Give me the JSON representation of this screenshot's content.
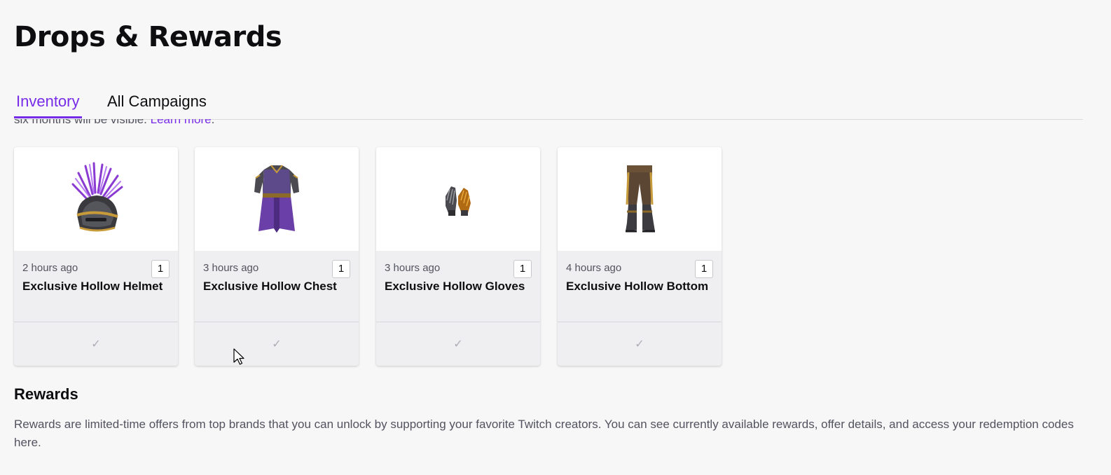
{
  "page": {
    "title": "Drops & Rewards"
  },
  "tabs": [
    {
      "label": "Inventory",
      "active": true
    },
    {
      "label": "All Campaigns",
      "active": false
    }
  ],
  "inventory_notice": {
    "text_visible": "six months will be visible. ",
    "link": "Learn more",
    "trailing": "."
  },
  "cards": [
    {
      "time": "2 hours ago",
      "quantity": "1",
      "name": "Exclusive Hollow Helmet",
      "icon": "helmet-image",
      "status_icon": "check-icon"
    },
    {
      "time": "3 hours ago",
      "quantity": "1",
      "name": "Exclusive Hollow Chest",
      "icon": "chest-armor-image",
      "status_icon": "check-icon"
    },
    {
      "time": "3 hours ago",
      "quantity": "1",
      "name": "Exclusive Hollow Gloves",
      "icon": "gloves-image",
      "status_icon": "check-icon"
    },
    {
      "time": "4 hours ago",
      "quantity": "1",
      "name": "Exclusive Hollow Bottom",
      "icon": "pants-image",
      "status_icon": "check-icon"
    }
  ],
  "rewards": {
    "title": "Rewards",
    "description": "Rewards are limited-time offers from top brands that you can unlock by supporting your favorite Twitch creators. You can see currently available rewards, offer details, and access your redemption codes here."
  },
  "colors": {
    "accent": "#772ce8",
    "background": "#f7f7f8",
    "card_body": "#efeff1",
    "muted_text": "#53535f"
  }
}
